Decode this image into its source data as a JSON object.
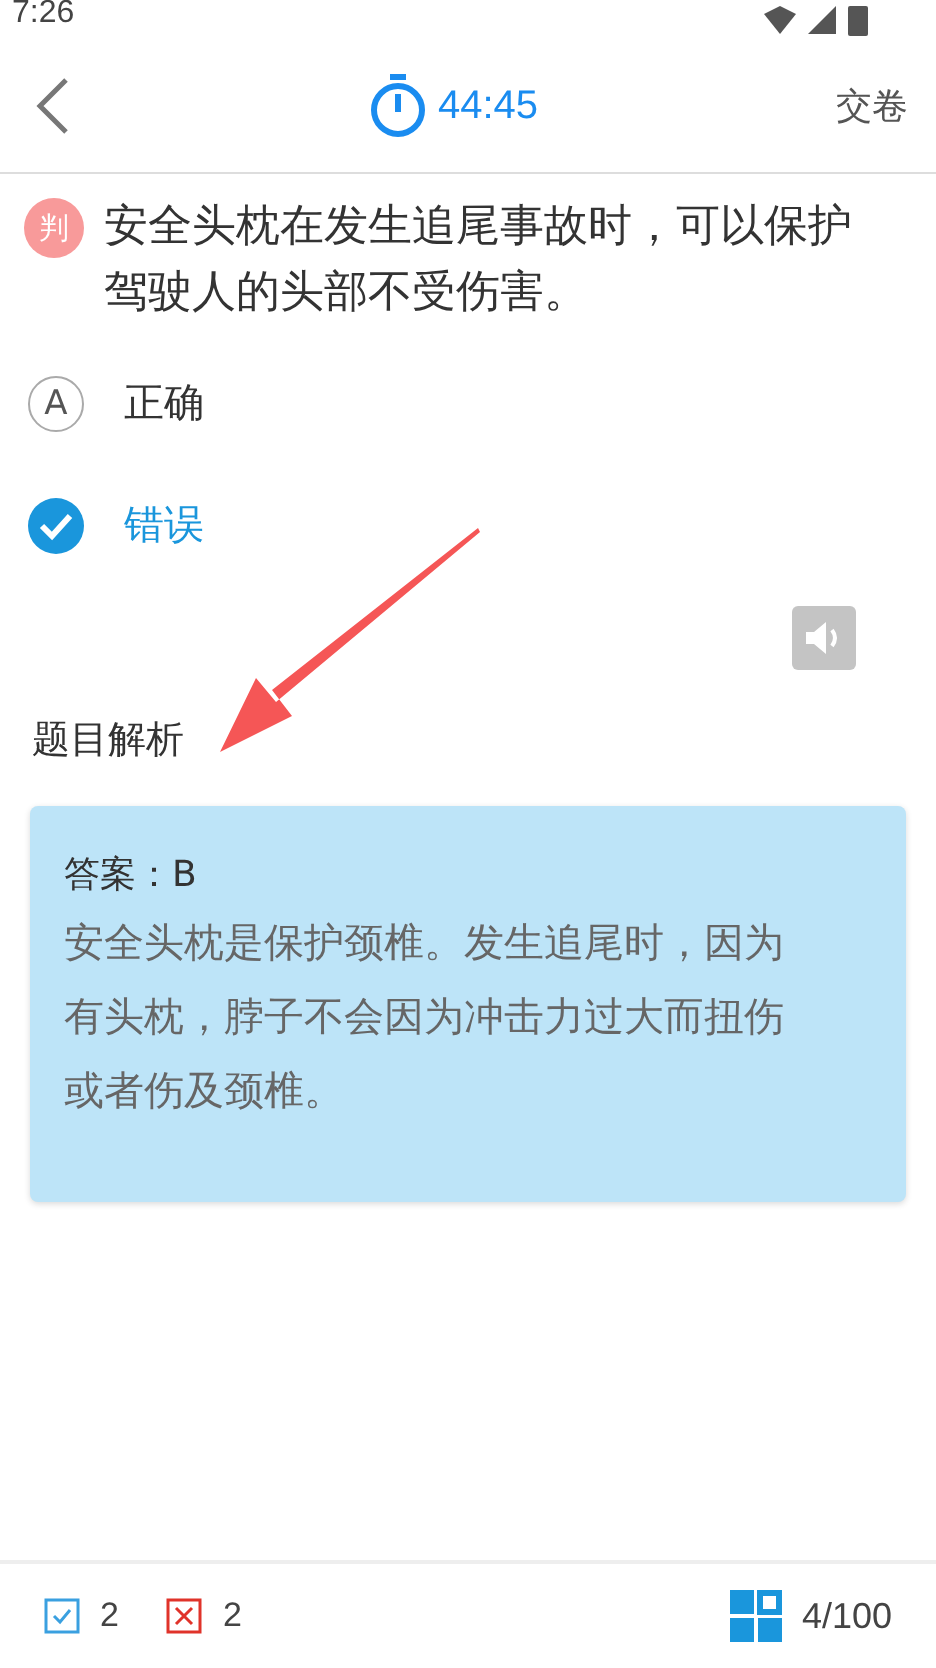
{
  "status_bar": {
    "time": "7:26"
  },
  "header": {
    "timer": "44:45",
    "submit": "交卷"
  },
  "question": {
    "type_badge": "判",
    "text": "安全头枕在发生追尾事故时，可以保护驾驶人的头部不受伤害。"
  },
  "options": [
    {
      "letter": "A",
      "text": "正确",
      "selected": false
    },
    {
      "text": "错误",
      "selected": true
    }
  ],
  "analysis": {
    "title": "题目解析",
    "answer": "答案：B",
    "explanation": "安全头枕是保护颈椎。发生追尾时，因为有头枕，脖子不会因为冲击力过大而扭伤或者伤及颈椎。"
  },
  "footer": {
    "correct_count": "2",
    "wrong_count": "2",
    "progress": "4/100"
  }
}
